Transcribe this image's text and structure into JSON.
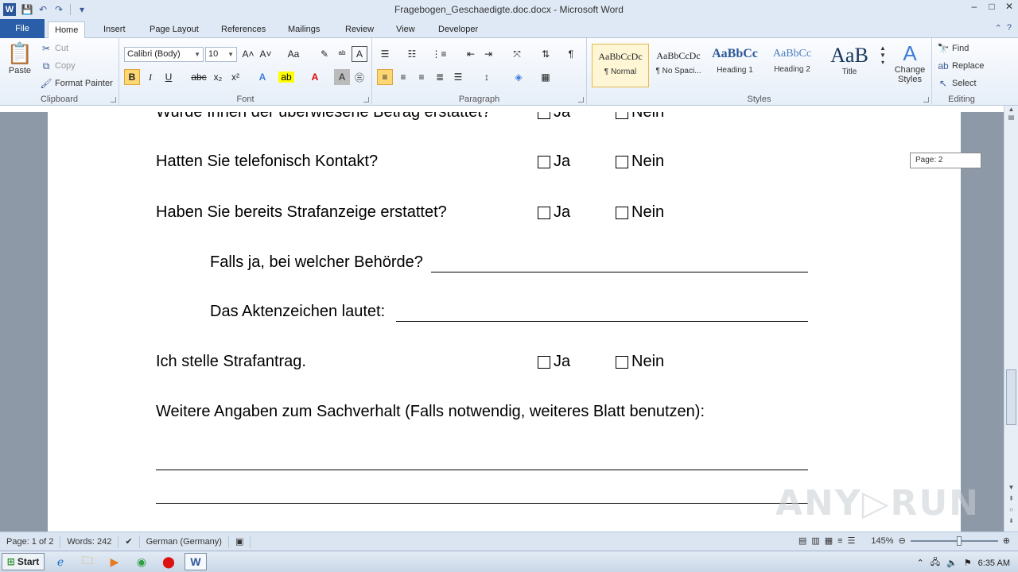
{
  "window": {
    "title": "Fragebogen_Geschaedigte.doc.docx - Microsoft Word",
    "app_logo": "W",
    "controls": [
      "–",
      "□",
      "✕"
    ]
  },
  "tabs": {
    "file": "File",
    "items": [
      "Home",
      "Insert",
      "Page Layout",
      "References",
      "Mailings",
      "Review",
      "View",
      "Developer"
    ],
    "active": "Home"
  },
  "ribbon": {
    "clipboard": {
      "paste": "Paste",
      "cut": "Cut",
      "copy": "Copy",
      "format_painter": "Format Painter",
      "label": "Clipboard"
    },
    "font": {
      "family": "Calibri (Body)",
      "size": "10",
      "label": "Font",
      "bold": "B",
      "italic": "I",
      "underline": "U",
      "strike": "abc",
      "sub": "x₂",
      "sup": "x²",
      "grow": "A˄",
      "shrink": "A˅",
      "case": "Aa"
    },
    "paragraph": {
      "label": "Paragraph",
      "pilcrow": "¶"
    },
    "styles": {
      "label": "Styles",
      "items": [
        {
          "sample": "AaBbCcDc",
          "name": "¶ Normal"
        },
        {
          "sample": "AaBbCcDc",
          "name": "¶ No Spaci..."
        },
        {
          "sample": "AaBbCc",
          "name": "Heading 1"
        },
        {
          "sample": "AaBbCc",
          "name": "Heading 2"
        },
        {
          "sample": "AaB",
          "name": "Title"
        }
      ],
      "change_styles": "Change Styles"
    },
    "editing": {
      "find": "Find",
      "replace": "Replace",
      "select": "Select",
      "label": "Editing"
    }
  },
  "document": {
    "partial_top": "Wurde Ihnen der überwiesene Betrag erstattet?",
    "q1": "Hatten Sie telefonisch Kontakt?",
    "q2": "Haben Sie bereits Strafanzeige erstattet?",
    "q2a": "Falls ja, bei welcher Behörde?",
    "q2b": "Das Aktenzeichen lautet:",
    "q3": "Ich stelle Strafantrag.",
    "q4": "Weitere Angaben zum Sachverhalt (Falls notwendig, weiteres Blatt benutzen):",
    "yes": "Ja",
    "no": "Nein"
  },
  "page_tooltip": "Page: 2",
  "status": {
    "page": "Page: 1 of 2",
    "words": "Words: 242",
    "language": "German (Germany)",
    "zoom": "145%",
    "zoom_percent": 145
  },
  "taskbar": {
    "start": "Start",
    "clock": "6:35 AM"
  },
  "watermark": "ANY▷RUN",
  "colors": {
    "file_tab": "#2a5ea8",
    "ribbon_bg": "#e6eef8",
    "doc_bg": "#8e99a8",
    "highlight": "#fcd774"
  }
}
